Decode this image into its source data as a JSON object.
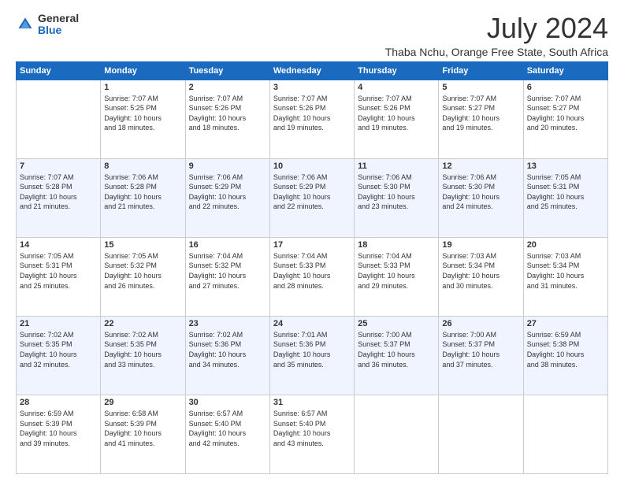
{
  "logo": {
    "line1": "General",
    "line2": "Blue"
  },
  "title": "July 2024",
  "subtitle": "Thaba Nchu, Orange Free State, South Africa",
  "weekdays": [
    "Sunday",
    "Monday",
    "Tuesday",
    "Wednesday",
    "Thursday",
    "Friday",
    "Saturday"
  ],
  "weeks": [
    [
      {
        "day": "",
        "info": ""
      },
      {
        "day": "1",
        "info": "Sunrise: 7:07 AM\nSunset: 5:25 PM\nDaylight: 10 hours\nand 18 minutes."
      },
      {
        "day": "2",
        "info": "Sunrise: 7:07 AM\nSunset: 5:26 PM\nDaylight: 10 hours\nand 18 minutes."
      },
      {
        "day": "3",
        "info": "Sunrise: 7:07 AM\nSunset: 5:26 PM\nDaylight: 10 hours\nand 19 minutes."
      },
      {
        "day": "4",
        "info": "Sunrise: 7:07 AM\nSunset: 5:26 PM\nDaylight: 10 hours\nand 19 minutes."
      },
      {
        "day": "5",
        "info": "Sunrise: 7:07 AM\nSunset: 5:27 PM\nDaylight: 10 hours\nand 19 minutes."
      },
      {
        "day": "6",
        "info": "Sunrise: 7:07 AM\nSunset: 5:27 PM\nDaylight: 10 hours\nand 20 minutes."
      }
    ],
    [
      {
        "day": "7",
        "info": "Sunrise: 7:07 AM\nSunset: 5:28 PM\nDaylight: 10 hours\nand 21 minutes."
      },
      {
        "day": "8",
        "info": "Sunrise: 7:06 AM\nSunset: 5:28 PM\nDaylight: 10 hours\nand 21 minutes."
      },
      {
        "day": "9",
        "info": "Sunrise: 7:06 AM\nSunset: 5:29 PM\nDaylight: 10 hours\nand 22 minutes."
      },
      {
        "day": "10",
        "info": "Sunrise: 7:06 AM\nSunset: 5:29 PM\nDaylight: 10 hours\nand 22 minutes."
      },
      {
        "day": "11",
        "info": "Sunrise: 7:06 AM\nSunset: 5:30 PM\nDaylight: 10 hours\nand 23 minutes."
      },
      {
        "day": "12",
        "info": "Sunrise: 7:06 AM\nSunset: 5:30 PM\nDaylight: 10 hours\nand 24 minutes."
      },
      {
        "day": "13",
        "info": "Sunrise: 7:05 AM\nSunset: 5:31 PM\nDaylight: 10 hours\nand 25 minutes."
      }
    ],
    [
      {
        "day": "14",
        "info": "Sunrise: 7:05 AM\nSunset: 5:31 PM\nDaylight: 10 hours\nand 25 minutes."
      },
      {
        "day": "15",
        "info": "Sunrise: 7:05 AM\nSunset: 5:32 PM\nDaylight: 10 hours\nand 26 minutes."
      },
      {
        "day": "16",
        "info": "Sunrise: 7:04 AM\nSunset: 5:32 PM\nDaylight: 10 hours\nand 27 minutes."
      },
      {
        "day": "17",
        "info": "Sunrise: 7:04 AM\nSunset: 5:33 PM\nDaylight: 10 hours\nand 28 minutes."
      },
      {
        "day": "18",
        "info": "Sunrise: 7:04 AM\nSunset: 5:33 PM\nDaylight: 10 hours\nand 29 minutes."
      },
      {
        "day": "19",
        "info": "Sunrise: 7:03 AM\nSunset: 5:34 PM\nDaylight: 10 hours\nand 30 minutes."
      },
      {
        "day": "20",
        "info": "Sunrise: 7:03 AM\nSunset: 5:34 PM\nDaylight: 10 hours\nand 31 minutes."
      }
    ],
    [
      {
        "day": "21",
        "info": "Sunrise: 7:02 AM\nSunset: 5:35 PM\nDaylight: 10 hours\nand 32 minutes."
      },
      {
        "day": "22",
        "info": "Sunrise: 7:02 AM\nSunset: 5:35 PM\nDaylight: 10 hours\nand 33 minutes."
      },
      {
        "day": "23",
        "info": "Sunrise: 7:02 AM\nSunset: 5:36 PM\nDaylight: 10 hours\nand 34 minutes."
      },
      {
        "day": "24",
        "info": "Sunrise: 7:01 AM\nSunset: 5:36 PM\nDaylight: 10 hours\nand 35 minutes."
      },
      {
        "day": "25",
        "info": "Sunrise: 7:00 AM\nSunset: 5:37 PM\nDaylight: 10 hours\nand 36 minutes."
      },
      {
        "day": "26",
        "info": "Sunrise: 7:00 AM\nSunset: 5:37 PM\nDaylight: 10 hours\nand 37 minutes."
      },
      {
        "day": "27",
        "info": "Sunrise: 6:59 AM\nSunset: 5:38 PM\nDaylight: 10 hours\nand 38 minutes."
      }
    ],
    [
      {
        "day": "28",
        "info": "Sunrise: 6:59 AM\nSunset: 5:39 PM\nDaylight: 10 hours\nand 39 minutes."
      },
      {
        "day": "29",
        "info": "Sunrise: 6:58 AM\nSunset: 5:39 PM\nDaylight: 10 hours\nand 41 minutes."
      },
      {
        "day": "30",
        "info": "Sunrise: 6:57 AM\nSunset: 5:40 PM\nDaylight: 10 hours\nand 42 minutes."
      },
      {
        "day": "31",
        "info": "Sunrise: 6:57 AM\nSunset: 5:40 PM\nDaylight: 10 hours\nand 43 minutes."
      },
      {
        "day": "",
        "info": ""
      },
      {
        "day": "",
        "info": ""
      },
      {
        "day": "",
        "info": ""
      }
    ]
  ]
}
